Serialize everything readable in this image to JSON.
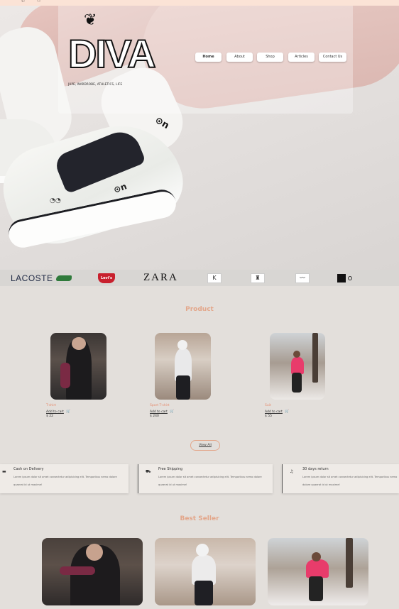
{
  "brand": {
    "logo_text": "DIVA",
    "tagline": "JUPE, WARDROBE, ATHLETICS, LIFE"
  },
  "nav": {
    "home": "Home",
    "about": "About",
    "shop": "Shop",
    "articles": "Articles",
    "contact": "Contact Us"
  },
  "brands": {
    "lacoste": "LACOSTE",
    "levis": "Levi's",
    "zara": "ZARA"
  },
  "product_section": {
    "title": "Product",
    "items": [
      {
        "name": "T-shirt",
        "cart": "Add to cart",
        "price": "$ 22"
      },
      {
        "name": "Sport T-shirt",
        "cart": "Add to cart",
        "price": "$ 240"
      },
      {
        "name": "Suit",
        "cart": "Add to cart",
        "price": "$ 55"
      }
    ],
    "view_all": "View All"
  },
  "features": [
    {
      "icon": "wallet-icon",
      "title": "Cash on Delivery",
      "text": "Lorem ipsum dolor sit amet consectetur adipisicing elit. Temporibus nemo dolore quaerat id ut maxime!"
    },
    {
      "icon": "truck-icon",
      "title": "Free Shipping",
      "text": "Lorem ipsum dolor sit amet consectetur adipisicing elit. Temporibus nemo dolore quaerat id ut maxime!"
    },
    {
      "icon": "headphones-icon",
      "title": "30 days return",
      "text": "Lorem ipsum dolor sit amet consectetur adipisicing elit. Temporibus nemo dolore quaerat id ut maxime!"
    }
  ],
  "best_seller": {
    "title": "Best Seller"
  },
  "colors": {
    "accent": "#e3a78b",
    "background": "#e3dfdb",
    "top_bar": "#fbe3d6"
  }
}
